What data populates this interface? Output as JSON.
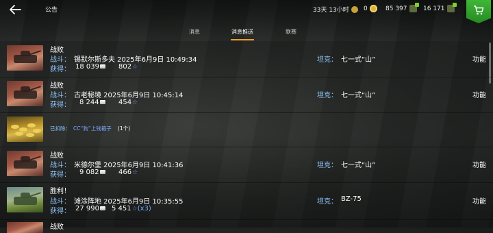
{
  "header": {
    "title": "公告",
    "timer": "33天 13小时",
    "gold": "0",
    "free_xp": "85 397",
    "silver": "16 171"
  },
  "tabs": [
    {
      "label": "消息",
      "active": false
    },
    {
      "label": "消息推送",
      "active": true
    },
    {
      "label": "联赛",
      "active": false
    }
  ],
  "labels": {
    "battle": "战斗：",
    "earned": "获得：",
    "tank": "坦克：",
    "function": "功能"
  },
  "rows": [
    {
      "type": "battle",
      "result": "战败",
      "map_time": "锡默尔斯多夫 2025年6月9日 10:49:34",
      "silver": "18 039",
      "xp": "802",
      "tank": "七一式“山”"
    },
    {
      "type": "battle",
      "result": "战败",
      "map_time": "古老秘境 2025年6月9日 10:45:14",
      "silver": "8 244",
      "xp": "454",
      "tank": "七一式“山”"
    },
    {
      "type": "notice",
      "prefix": "已扣除：",
      "item": "CC“狗”上钱箱子",
      "count": "(1个)"
    },
    {
      "type": "battle",
      "result": "战败",
      "map_time": "米德尔堡 2025年6月9日 10:41:36",
      "silver": "9 082",
      "xp": "466",
      "tank": "七一式“山”"
    },
    {
      "type": "battle",
      "result": "胜利！",
      "map_time": "滩涂阵地 2025年6月9日 10:35:55",
      "silver": "27 990",
      "xp": "5 451",
      "xp_mult": "(x3)",
      "tank": "BZ-75"
    },
    {
      "type": "battle",
      "result": "战败"
    }
  ],
  "colors": {
    "label_blue": "#8dc4ff",
    "tab_accent": "#f0a020",
    "shop_green": "#3fb737"
  },
  "icons": {
    "back": "back-arrow-icon",
    "premium": "premium-laurel-icon",
    "gold": "gold-plus-icon",
    "free_xp": "free-xp-plus-icon",
    "silver": "silver-plus-icon",
    "shop": "shop-cart-icon",
    "silver_coin": "silver-coin-icon",
    "xp_star": "xp-star-icon"
  }
}
